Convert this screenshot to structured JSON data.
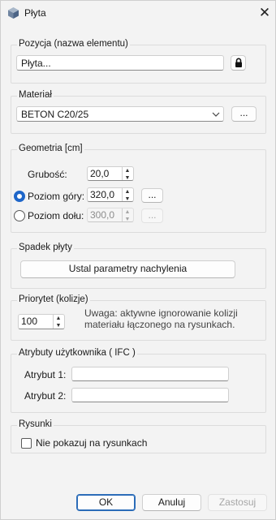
{
  "window": {
    "title": "Płyta",
    "app_icon": "cube-icon",
    "close_label": "✕"
  },
  "pozycja": {
    "legend": "Pozycja (nazwa elementu)",
    "value": "Płyta...",
    "lock_icon": "lock-icon"
  },
  "material": {
    "legend": "Materiał",
    "selected": "BETON C20/25",
    "browse_label": "..."
  },
  "geometria": {
    "legend": "Geometria [cm]",
    "grubosc_label": "Grubość:",
    "grubosc_value": "20,0",
    "poziom_gory_label": "Poziom góry:",
    "poziom_gory_value": "320,0",
    "poziom_gory_checked": true,
    "poziom_gory_browse": "...",
    "poziom_dolu_label": "Poziom dołu:",
    "poziom_dolu_value": "300,0",
    "poziom_dolu_checked": false,
    "poziom_dolu_browse": "..."
  },
  "spadek": {
    "legend": "Spadek płyty",
    "button_label": "Ustal parametry nachylenia"
  },
  "priorytet": {
    "legend": "Priorytet (kolizje)",
    "value": "100",
    "note_line1": "Uwaga: aktywne ignorowanie kolizji",
    "note_line2": "materiału łączonego na rysunkach."
  },
  "atrybuty": {
    "legend": "Atrybuty użytkownika ( IFC )",
    "attr1_label": "Atrybut 1:",
    "attr1_value": "",
    "attr2_label": "Atrybut 2:",
    "attr2_value": ""
  },
  "rysunki": {
    "legend": "Rysunki",
    "checkbox_label": "Nie pokazuj na rysunkach",
    "checked": false
  },
  "footer": {
    "ok_label": "OK",
    "cancel_label": "Anuluj",
    "apply_label": "Zastosuj"
  },
  "colors": {
    "accent": "#1e66c9",
    "background": "#f3f3f3"
  }
}
